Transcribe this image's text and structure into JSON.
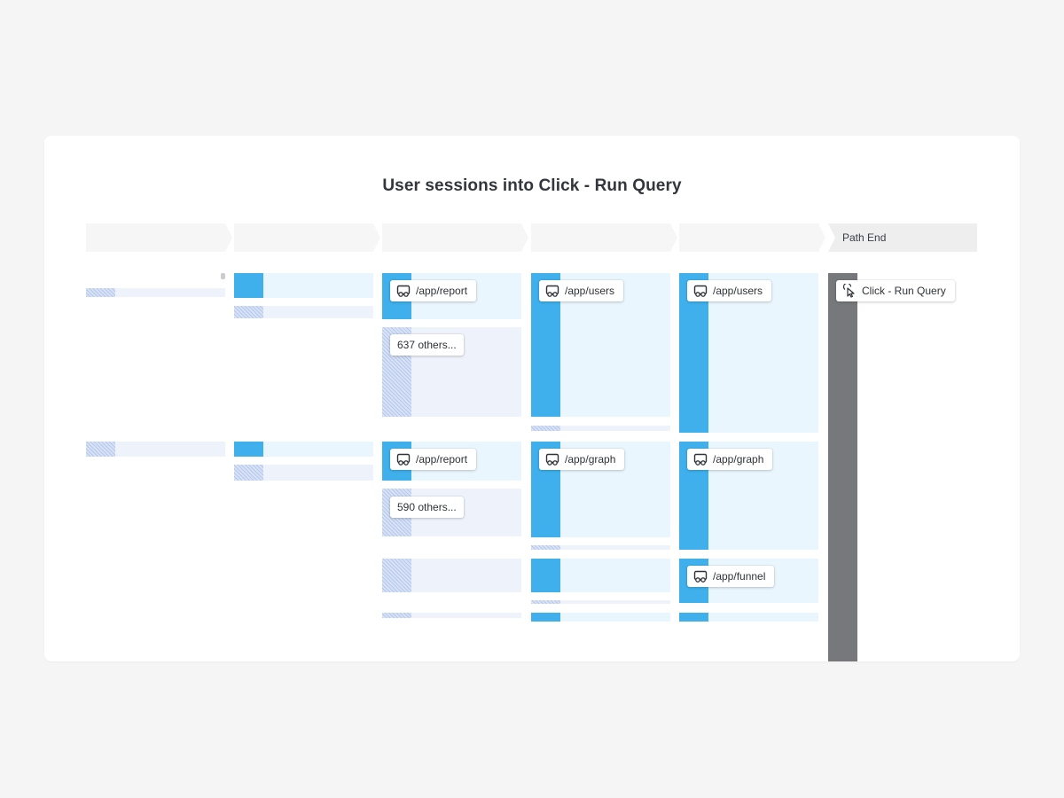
{
  "title": "User sessions into Click - Run Query",
  "steps": [
    "",
    "",
    "",
    "",
    "",
    "Path End"
  ],
  "colors": {
    "bar": "#3fb0ec",
    "path_end": "#77787b",
    "block": "#eaf6fd",
    "other_block": "#eef2fb"
  },
  "nodes": {
    "c3_report_1": "/app/report",
    "c3_others_1": "637 others...",
    "c4_users": "/app/users",
    "c5_users": "/app/users",
    "c6_end": "Click - Run Query",
    "c3_report_2": "/app/report",
    "c3_others_2": "590 others...",
    "c4_graph": "/app/graph",
    "c5_graph": "/app/graph",
    "c5_funnel": "/app/funnel"
  },
  "icons": {
    "page": "page-view-icon",
    "click": "cursor-click-icon"
  }
}
